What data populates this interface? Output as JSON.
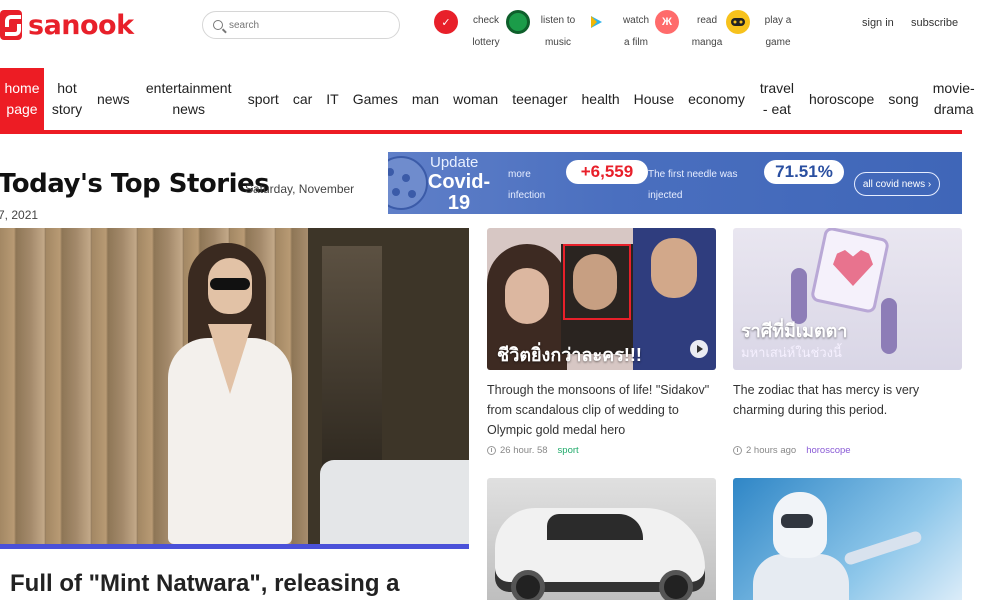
{
  "brand": {
    "name": "sanook",
    "color": "#e8202a"
  },
  "search": {
    "placeholder": "search"
  },
  "quick_links": [
    {
      "icon": "lottery-icon",
      "line1": "check",
      "line2": "lottery"
    },
    {
      "icon": "music-icon",
      "line1": "listen to",
      "line2": "music"
    },
    {
      "icon": "film-icon",
      "line1": "watch",
      "line2": "a film"
    },
    {
      "icon": "manga-icon",
      "line1": "read",
      "line2": "manga",
      "badge": "Ж"
    },
    {
      "icon": "game-icon",
      "line1": "play a",
      "line2": "game"
    }
  ],
  "auth": {
    "sign_in": "sign in",
    "subscribe": "subscribe"
  },
  "nav": {
    "items": [
      {
        "label": "home page",
        "active": true
      },
      {
        "label": "hot story"
      },
      {
        "label": "news"
      },
      {
        "label": "entertainment news"
      },
      {
        "label": "sport"
      },
      {
        "label": "car"
      },
      {
        "label": "IT"
      },
      {
        "label": "Games"
      },
      {
        "label": "man"
      },
      {
        "label": "woman"
      },
      {
        "label": "teenager"
      },
      {
        "label": "health"
      },
      {
        "label": "House"
      },
      {
        "label": "economy"
      },
      {
        "label": "travel - eat"
      },
      {
        "label": "horoscope"
      },
      {
        "label": "song"
      },
      {
        "label": "movie-drama"
      }
    ],
    "accent": "#ed1c24"
  },
  "headline": {
    "title": "Today's Top Stories",
    "date_line1": "Saturday, November",
    "date_line2": "7, 2021"
  },
  "covid": {
    "update": "Update",
    "title_line1": "Covid-",
    "title_line2": "19",
    "more_line1": "more",
    "more_line2": "infection",
    "infections": "+6,559",
    "first_needle_line1": "The first needle was",
    "first_needle_line2": "injected",
    "vaccinated": "71.51%",
    "all_news": "all covid news ›"
  },
  "main_story": {
    "title": "Full of \"Mint Natwara\", releasing a",
    "bar_color": "#4a51d9"
  },
  "cards": [
    {
      "overlay": "ชีวิตยิ่งกว่าละคร!!!",
      "title": "Through the monsoons of life! \"Sidakov\" from scandalous clip of wedding to Olympic gold medal hero",
      "time": "26 hour. 58",
      "category": "sport"
    },
    {
      "overlay": "ราศีที่มีเมตตา",
      "overlay_sub": "มหาเสน่ห์ในช่วงนี้",
      "title": "The zodiac that has mercy is very charming during this period.",
      "time": "2 hours ago",
      "category": "horoscope"
    },
    {
      "image": "car"
    },
    {
      "image": "robot"
    }
  ]
}
